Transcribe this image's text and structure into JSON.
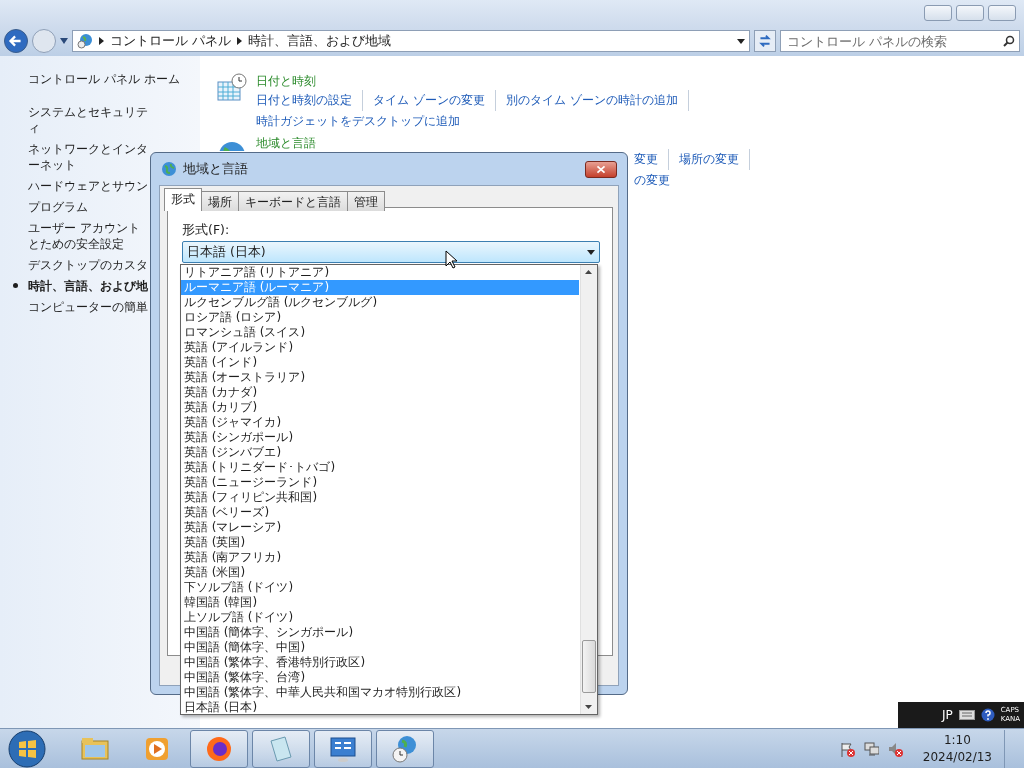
{
  "address_bar": {
    "breadcrumbs": [
      "コントロール パネル",
      "時計、言語、および地域"
    ]
  },
  "search": {
    "placeholder": "コントロール パネルの検索"
  },
  "sidebar": {
    "home": "コントロール パネル ホーム",
    "items": [
      {
        "label": "システムとセキュリティ",
        "selected": false
      },
      {
        "label": "ネットワークとインターネット",
        "selected": false
      },
      {
        "label": "ハードウェアとサウン",
        "selected": false
      },
      {
        "label": "プログラム",
        "selected": false
      },
      {
        "label": "ユーザー アカウントとための安全設定",
        "selected": false
      },
      {
        "label": "デスクトップのカスタ",
        "selected": false
      },
      {
        "label": "時計、言語、および地",
        "selected": true
      },
      {
        "label": "コンピューターの簡単",
        "selected": false
      }
    ]
  },
  "content": {
    "sections": [
      {
        "kind": "clock",
        "title": "日付と時刻",
        "links": [
          "日付と時刻の設定",
          "タイム ゾーンの変更",
          "別のタイム ゾーンの時計の追加",
          "時計ガジェットをデスクトップに追加"
        ]
      },
      {
        "kind": "globe",
        "title": "地域と言語",
        "links": [
          "変更",
          "場所の変更",
          "の変更"
        ]
      }
    ]
  },
  "dialog": {
    "title": "地域と言語",
    "tabs": [
      {
        "label": "形式",
        "selected": true
      },
      {
        "label": "場所",
        "selected": false
      },
      {
        "label": "キーボードと言語",
        "selected": false
      },
      {
        "label": "管理",
        "selected": false
      }
    ],
    "format_label": "形式(F):",
    "format_value": "日本語 (日本)",
    "options": [
      {
        "label": "リトアニア語 (リトアニア)",
        "selected": false
      },
      {
        "label": "ルーマニア語 (ルーマニア)",
        "selected": true
      },
      {
        "label": "ルクセンブルグ語 (ルクセンブルグ)",
        "selected": false
      },
      {
        "label": "ロシア語 (ロシア)",
        "selected": false
      },
      {
        "label": "ロマンシュ語 (スイス)",
        "selected": false
      },
      {
        "label": "英語 (アイルランド)",
        "selected": false
      },
      {
        "label": "英語 (インド)",
        "selected": false
      },
      {
        "label": "英語 (オーストラリア)",
        "selected": false
      },
      {
        "label": "英語 (カナダ)",
        "selected": false
      },
      {
        "label": "英語 (カリブ)",
        "selected": false
      },
      {
        "label": "英語 (ジャマイカ)",
        "selected": false
      },
      {
        "label": "英語 (シンガポール)",
        "selected": false
      },
      {
        "label": "英語 (ジンバブエ)",
        "selected": false
      },
      {
        "label": "英語 (トリニダード･トバゴ)",
        "selected": false
      },
      {
        "label": "英語 (ニュージーランド)",
        "selected": false
      },
      {
        "label": "英語 (フィリピン共和国)",
        "selected": false
      },
      {
        "label": "英語 (ベリーズ)",
        "selected": false
      },
      {
        "label": "英語 (マレーシア)",
        "selected": false
      },
      {
        "label": "英語 (英国)",
        "selected": false
      },
      {
        "label": "英語 (南アフリカ)",
        "selected": false
      },
      {
        "label": "英語 (米国)",
        "selected": false
      },
      {
        "label": "下ソルブ語 (ドイツ)",
        "selected": false
      },
      {
        "label": "韓国語 (韓国)",
        "selected": false
      },
      {
        "label": "上ソルブ語 (ドイツ)",
        "selected": false
      },
      {
        "label": "中国語 (簡体字、シンガポール)",
        "selected": false
      },
      {
        "label": "中国語 (簡体字、中国)",
        "selected": false
      },
      {
        "label": "中国語 (繁体字、香港特別行政区)",
        "selected": false
      },
      {
        "label": "中国語 (繁体字、台湾)",
        "selected": false
      },
      {
        "label": "中国語 (繁体字、中華人民共和国マカオ特別行政区)",
        "selected": false
      },
      {
        "label": "日本語 (日本)",
        "selected": false
      }
    ]
  },
  "language_bar": {
    "language": "JP",
    "caps": "CAPS",
    "kana": "KANA"
  },
  "taskbar": {
    "buttons": [
      {
        "kind": "folder",
        "open": false
      },
      {
        "kind": "media",
        "open": false
      },
      {
        "kind": "browser",
        "open": true
      },
      {
        "kind": "notepad",
        "open": true
      },
      {
        "kind": "panel",
        "open": true
      },
      {
        "kind": "globe",
        "open": true
      }
    ],
    "time": "1:10",
    "date": "2024/02/13"
  }
}
